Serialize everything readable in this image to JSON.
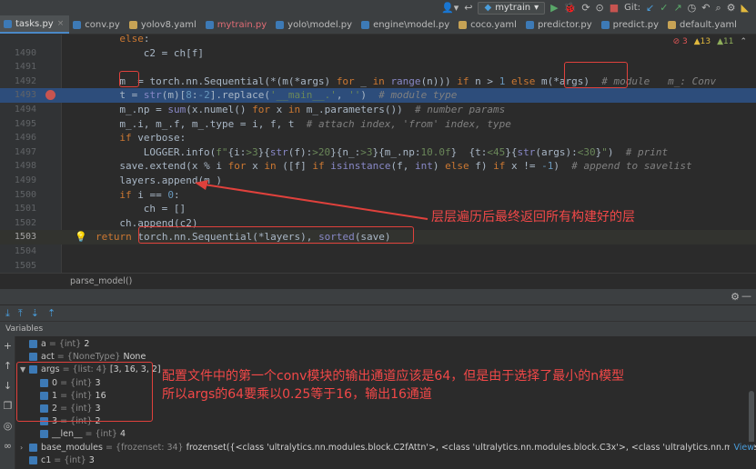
{
  "tabs": [
    {
      "label": "tasks.py",
      "active": true,
      "color": "#3d7ab6"
    },
    {
      "label": "conv.py",
      "active": false,
      "color": "#3d7ab6"
    },
    {
      "label": "yolov8.yaml",
      "active": false,
      "color": "#c7a355"
    },
    {
      "label": "mytrain.py",
      "active": false,
      "color": "#3d7ab6",
      "red": true
    },
    {
      "label": "yolo\\model.py",
      "active": false,
      "color": "#3d7ab6"
    },
    {
      "label": "engine\\model.py",
      "active": false,
      "color": "#3d7ab6"
    },
    {
      "label": "coco.yaml",
      "active": false,
      "color": "#c7a355"
    },
    {
      "label": "predictor.py",
      "active": false,
      "color": "#3d7ab6"
    },
    {
      "label": "predict.py",
      "active": false,
      "color": "#3d7ab6"
    },
    {
      "label": "default.yaml",
      "active": false,
      "color": "#c7a355"
    }
  ],
  "toolbar": {
    "run_config": "mytrain",
    "git_label": "Git:"
  },
  "warnings": {
    "errors": "3",
    "warnings": "13",
    "infos": "11"
  },
  "editor": {
    "lines": [
      {
        "num": "",
        "html": "<span class=\"kw\">else</span>:",
        "indent": 4
      },
      {
        "num": "1490",
        "html": "c2 = ch[f]",
        "indent": 8
      },
      {
        "num": "1491",
        "html": "",
        "indent": 0
      },
      {
        "num": "1492",
        "html": "m_ = torch.nn.Sequential(*(m(*args) <span class=\"kw\">for</span> _ <span class=\"kw\">in</span> <span class=\"bi\">range</span>(n))) <span class=\"kw\">if</span> n > <span class=\"nm\">1</span> <span class=\"kw\">else</span> m(*args)  <span class=\"cm\"># module   m_: Conv</span>",
        "indent": 4
      },
      {
        "num": "1493",
        "html": "t = <span class=\"bi\">str</span>(m)[<span class=\"nm\">8</span>:<span class=\"nm\">-2</span>].replace(<span class=\"st\">'__main__.'</span>, <span class=\"st\">''</span>)  <span class=\"cm\"># module type</span>",
        "indent": 4,
        "hl": true
      },
      {
        "num": "1494",
        "html": "m_.np = <span class=\"bi\">sum</span>(x.numel() <span class=\"kw\">for</span> x <span class=\"kw\">in</span> m_.parameters())  <span class=\"cm\"># number params</span>",
        "indent": 4
      },
      {
        "num": "1495",
        "html": "m_.i, m_.f, m_.type = i, f, t  <span class=\"cm\"># attach index, 'from' index, type</span>",
        "indent": 4
      },
      {
        "num": "1496",
        "html": "<span class=\"kw\">if</span> verbose:",
        "indent": 4
      },
      {
        "num": "1497",
        "html": "LOGGER.info(<span class=\"st\">f\"</span>{i:<span class=\"st\">&gt;3</span>}{<span class=\"bi\">str</span>(f):<span class=\"st\">&gt;20</span>}{n_:<span class=\"st\">&gt;3</span>}{m_.np:<span class=\"st\">10.0f</span>}<span class=\"st\">  </span>{t:<span class=\"st\">&lt;45</span>}{<span class=\"bi\">str</span>(args):<span class=\"st\">&lt;30</span>}<span class=\"st\">\"</span>)  <span class=\"cm\"># print</span>",
        "indent": 8
      },
      {
        "num": "1498",
        "html": "save.extend(x % i <span class=\"kw\">for</span> x <span class=\"kw\">in</span> ([f] <span class=\"kw\">if</span> <span class=\"bi\">isinstance</span>(f, <span class=\"bi\">int</span>) <span class=\"kw\">else</span> f) <span class=\"kw\">if</span> x != <span class=\"nm\">-1</span>)  <span class=\"cm\"># append to savelist</span>",
        "indent": 4
      },
      {
        "num": "1499",
        "html": "layers.append(m_)",
        "indent": 4
      },
      {
        "num": "1500",
        "html": "<span class=\"kw\">if</span> i == <span class=\"nm\">0</span>:",
        "indent": 4
      },
      {
        "num": "1501",
        "html": "ch = []",
        "indent": 8
      },
      {
        "num": "1502",
        "html": "ch.append(c2)",
        "indent": 4
      },
      {
        "num": "1503",
        "html": "<span class=\"kw\">return</span> torch.nn.Sequential(*layers), <span class=\"bi\">sorted</span>(save)",
        "indent": 0,
        "cur": true
      },
      {
        "num": "1504",
        "html": "",
        "indent": 0
      },
      {
        "num": "1505",
        "html": "",
        "indent": 0
      }
    ]
  },
  "annotation_code": "层层遍历后最终返回所有构建好的层",
  "breadcrumb": "parse_model()",
  "debug": {
    "panel_title": "Variables",
    "annotation_line1": "配置文件中的第一个conv模块的输出通道应该是64，但是由于选择了最小的n模型",
    "annotation_line2": "所以args的64要乘以0.25等于16，输出16通道",
    "vars": [
      {
        "arrow": "",
        "name": "a",
        "type": " = {int} ",
        "val": "2",
        "indent": 0
      },
      {
        "arrow": "",
        "name": "act",
        "type": " = {NoneType} ",
        "val": "None",
        "indent": 0
      },
      {
        "arrow": "▼",
        "name": "args",
        "type": " = {list: 4} ",
        "val": "[3, 16, 3, 2]",
        "indent": 0
      },
      {
        "arrow": "",
        "name": "0",
        "type": " = {int} ",
        "val": "3",
        "indent": 1
      },
      {
        "arrow": "",
        "name": "1",
        "type": " = {int} ",
        "val": "16",
        "indent": 1
      },
      {
        "arrow": "",
        "name": "2",
        "type": " = {int} ",
        "val": "3",
        "indent": 1
      },
      {
        "arrow": "",
        "name": "3",
        "type": " = {int} ",
        "val": "2",
        "indent": 1
      },
      {
        "arrow": "",
        "name": "__len__",
        "type": " = {int} ",
        "val": "4",
        "indent": 1
      },
      {
        "arrow": "›",
        "name": "base_modules",
        "type": " = {frozenset: 34} ",
        "val": "frozenset({<class 'ultralytics.nn.modules.block.C2fAttn'>, <class 'ultralytics.nn.modules.block.C3x'>, <class 'ultralytics.nn.modules.conv.DWConv'>, <class",
        "indent": 0,
        "more": "View"
      },
      {
        "arrow": "",
        "name": "c1",
        "type": " = {int} ",
        "val": "3",
        "indent": 0
      }
    ]
  }
}
